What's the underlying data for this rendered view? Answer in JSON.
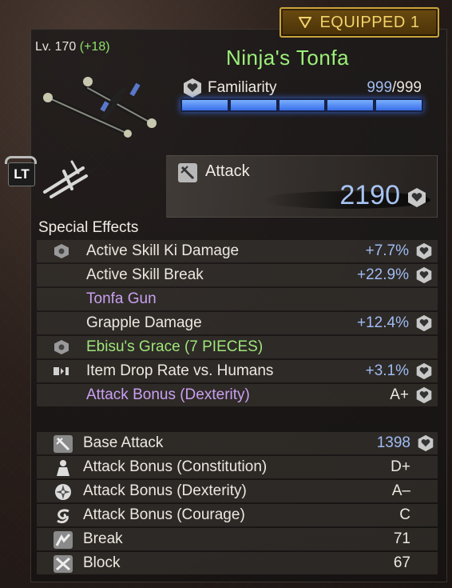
{
  "equipped_label": "EQUIPPED 1",
  "weapon": {
    "level_text": "Lv. 170",
    "level_bonus": "(+18)",
    "name": "Ninja's Tonfa"
  },
  "familiarity": {
    "label": "Familiarity",
    "current": "999",
    "separator": "/",
    "max": "999",
    "fill_fraction": 1.0,
    "segments": 5
  },
  "lt_button": "LT",
  "attack": {
    "label": "Attack",
    "value": "2190"
  },
  "special_effects_title": "Special Effects",
  "special_effects": [
    {
      "icon": "hexagon-icon",
      "label": "Active Skill Ki Damage",
      "value": "+7.7%",
      "locked": true,
      "style": "normal"
    },
    {
      "icon": "",
      "label": "Active Skill Break",
      "value": "+22.9%",
      "locked": true,
      "style": "normal"
    },
    {
      "icon": "",
      "label": "Tonfa Gun",
      "value": "",
      "locked": false,
      "style": "purple"
    },
    {
      "icon": "",
      "label": "Grapple Damage",
      "value": "+12.4%",
      "locked": true,
      "style": "normal"
    },
    {
      "icon": "hexagon-icon",
      "label": "Ebisu's Grace (7 PIECES)",
      "value": "",
      "locked": false,
      "style": "green"
    },
    {
      "icon": "mask-icon",
      "label": "Item Drop Rate vs. Humans",
      "value": "+3.1%",
      "locked": true,
      "style": "normal"
    },
    {
      "icon": "",
      "label": "Attack Bonus (Dexterity)",
      "value": "A+",
      "locked": true,
      "style": "purple"
    }
  ],
  "stats": [
    {
      "icon": "sword-icon",
      "label": "Base Attack",
      "value": "1398",
      "locked": true,
      "blue": true
    },
    {
      "icon": "figure-icon",
      "label": "Attack Bonus (Constitution)",
      "value": "D+",
      "locked": false,
      "blue": false
    },
    {
      "icon": "shuriken-icon",
      "label": "Attack Bonus (Dexterity)",
      "value": "A–",
      "locked": false,
      "blue": false
    },
    {
      "icon": "swirl-icon",
      "label": "Attack Bonus (Courage)",
      "value": "C",
      "locked": false,
      "blue": false
    },
    {
      "icon": "break-icon",
      "label": "Break",
      "value": "71",
      "locked": false,
      "blue": false
    },
    {
      "icon": "block-icon",
      "label": "Block",
      "value": "67",
      "locked": false,
      "blue": false
    }
  ],
  "colors": {
    "name_green": "#9cf07a",
    "value_blue": "#9fbcf2",
    "purple": "#c9a0f0",
    "gold": "#f2d36a"
  }
}
